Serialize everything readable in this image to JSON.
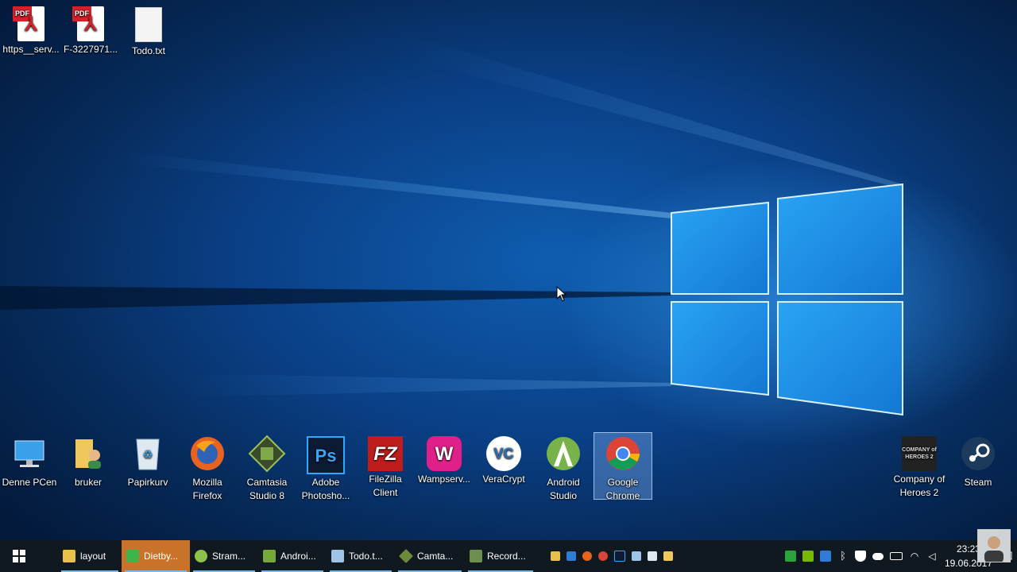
{
  "desktop": {
    "top_icons": [
      {
        "name": "https-serv-pdf-icon",
        "label": "https__serv..."
      },
      {
        "name": "f-3227971-pdf-icon",
        "label": "F-3227971..."
      },
      {
        "name": "todo-txt-file-icon",
        "label": "Todo.txt"
      }
    ],
    "pdf_tag": "PDF",
    "bottom_icons": [
      {
        "label": "Denne PCen"
      },
      {
        "label": "bruker"
      },
      {
        "label": "Papirkurv"
      },
      {
        "label": "Mozilla Firefox"
      },
      {
        "label": "Camtasia Studio 8"
      },
      {
        "label": "Adobe Photosho..."
      },
      {
        "label": "FileZilla Client"
      },
      {
        "label": "Wampserv..."
      },
      {
        "label": "VeraCrypt"
      },
      {
        "label": "Android Studio"
      },
      {
        "label": "Google Chrome"
      }
    ],
    "right_icons": [
      {
        "label": "Company of Heroes 2"
      },
      {
        "label": "Steam"
      }
    ],
    "logo_text": {
      "ps": "Ps",
      "fz": "FZ",
      "wamp": "W",
      "vc": "VC",
      "coh": "COMPANY of HEROES 2"
    }
  },
  "taskbar": {
    "buttons": [
      {
        "label": "layout",
        "color": "#e8c14a",
        "state": "open"
      },
      {
        "label": "Dietby...",
        "color": "#3db54a",
        "state": "active"
      },
      {
        "label": "Stram...",
        "color": "#8fc04a",
        "state": "open"
      },
      {
        "label": "Androi...",
        "color": "#77a93a",
        "state": "open"
      },
      {
        "label": "Todo.t...",
        "color": "#9ec5e8",
        "state": "open"
      },
      {
        "label": "Camta...",
        "color": "#6c8a3a",
        "state": "open"
      },
      {
        "label": "Record...",
        "color": "#6b8f4c",
        "state": "open"
      }
    ],
    "clock": {
      "time": "23:23",
      "date": "19.06.2017"
    }
  },
  "colors": {
    "taskbar": "#101820",
    "active_button": "#c9732a",
    "selection": "#8cbeff"
  }
}
